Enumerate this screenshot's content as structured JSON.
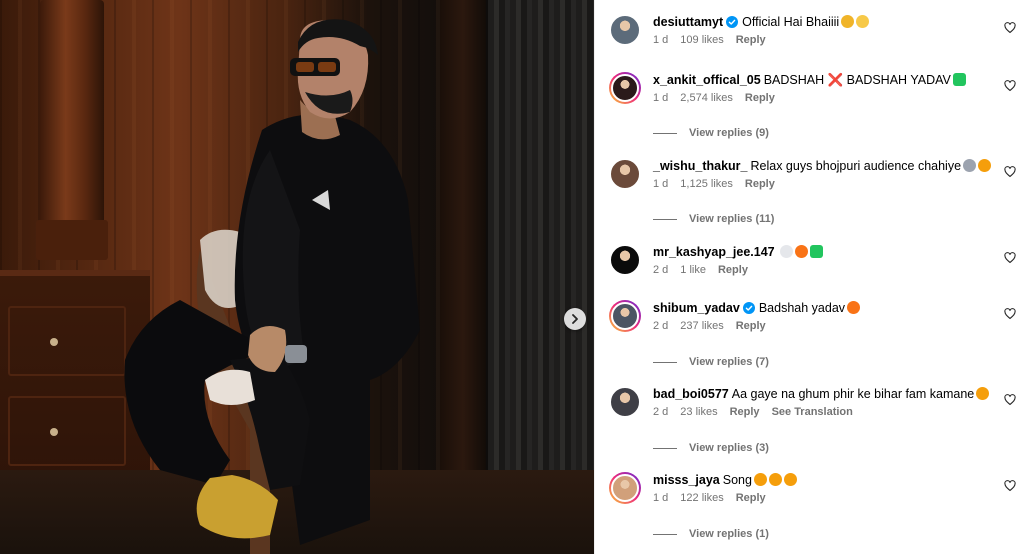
{
  "photo": {
    "alt": ""
  },
  "comments": [
    {
      "username": "desiuttamyt",
      "verified": true,
      "text": "Official Hai Bhaiiii",
      "emojis": [
        "#f0b429",
        "#f7c948"
      ],
      "time": "1 d",
      "likes": "109 likes",
      "reply": "Reply",
      "view_replies": "",
      "ring": false,
      "avatar_color": "#5c6b7a"
    },
    {
      "username": "x_ankit_offical_05",
      "verified": false,
      "text": "BADSHAH ❌ BADSHAH YADAV",
      "emojis": [
        "#22c55e"
      ],
      "time": "1 d",
      "likes": "2,574 likes",
      "reply": "Reply",
      "view_replies": "View replies (9)",
      "ring": true,
      "avatar_color": "#2b1a1a"
    },
    {
      "username": "_wishu_thakur_",
      "verified": false,
      "text": "Relax guys bhojpuri audience chahiye",
      "emojis": [
        "#9ca3af",
        "#f59e0b"
      ],
      "time": "1 d",
      "likes": "1,125 likes",
      "reply": "Reply",
      "view_replies": "View replies (11)",
      "ring": false,
      "avatar_color": "#6b4a3a"
    },
    {
      "username": "mr_kashyap_jee.147",
      "verified": false,
      "text": "",
      "emojis": [
        "#e5e7eb",
        "#f97316",
        "#22c55e"
      ],
      "time": "2 d",
      "likes": "1 like",
      "reply": "Reply",
      "view_replies": "",
      "ring": false,
      "avatar_color": "#0b0b0b"
    },
    {
      "username": "shibum_yadav",
      "verified": true,
      "text": "Badshah yadav",
      "emojis": [
        "#f97316"
      ],
      "time": "2 d",
      "likes": "237 likes",
      "reply": "Reply",
      "view_replies": "View replies (7)",
      "ring": true,
      "avatar_color": "#4b5563"
    },
    {
      "username": "bad_boi0577",
      "verified": false,
      "text": "Aa gaye na ghum phir ke bihar fam kamane",
      "emojis": [
        "#f59e0b"
      ],
      "time": "2 d",
      "likes": "23 likes",
      "reply": "Reply",
      "translate": "See Translation",
      "view_replies": "View replies (3)",
      "ring": false,
      "avatar_color": "#3f3f46"
    },
    {
      "username": "misss_jaya",
      "verified": false,
      "text": "Song",
      "emojis": [
        "#f59e0b",
        "#f59e0b",
        "#f59e0b"
      ],
      "time": "1 d",
      "likes": "122 likes",
      "reply": "Reply",
      "view_replies": "View replies (1)",
      "ring": true,
      "avatar_color": "#d1a07a"
    }
  ]
}
